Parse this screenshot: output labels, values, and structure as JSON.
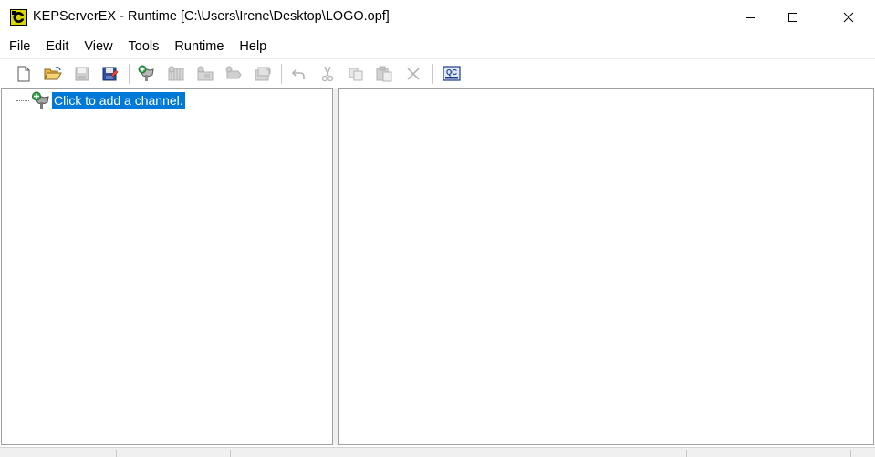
{
  "window": {
    "title": "KEPServerEX - Runtime [C:\\Users\\Irene\\Desktop\\LOGO.opf]",
    "controls": {
      "minimize": "minimize-icon",
      "maximize": "maximize-icon",
      "close": "close-icon"
    }
  },
  "menu": {
    "items": [
      "File",
      "Edit",
      "View",
      "Tools",
      "Runtime",
      "Help"
    ]
  },
  "toolbar": {
    "buttons": [
      {
        "icon": "new-project-icon",
        "enabled": true
      },
      {
        "icon": "open-folder-icon",
        "enabled": true
      },
      {
        "icon": "save-icon",
        "enabled": false
      },
      {
        "icon": "save-as-icon",
        "enabled": true
      },
      {
        "icon": "new-channel-icon",
        "enabled": true
      },
      {
        "icon": "new-device-icon",
        "enabled": false
      },
      {
        "icon": "new-tag-group-icon",
        "enabled": false
      },
      {
        "icon": "new-tag-icon",
        "enabled": false
      },
      {
        "icon": "bulk-tags-icon",
        "enabled": false
      },
      {
        "icon": "undo-icon",
        "enabled": false
      },
      {
        "icon": "cut-icon",
        "enabled": false
      },
      {
        "icon": "copy-icon",
        "enabled": false
      },
      {
        "icon": "paste-icon",
        "enabled": false
      },
      {
        "icon": "delete-icon",
        "enabled": false
      },
      {
        "icon": "quick-client-icon",
        "enabled": true
      }
    ],
    "quick_client_label": "QC"
  },
  "tree": {
    "nodes": [
      {
        "label": "Click to add a channel.",
        "icon": "add-channel-icon",
        "selected": true
      }
    ]
  },
  "colors": {
    "selection": "#0078d7",
    "border": "#a0a0a0",
    "disabled_icon": "#b4b4b4"
  }
}
